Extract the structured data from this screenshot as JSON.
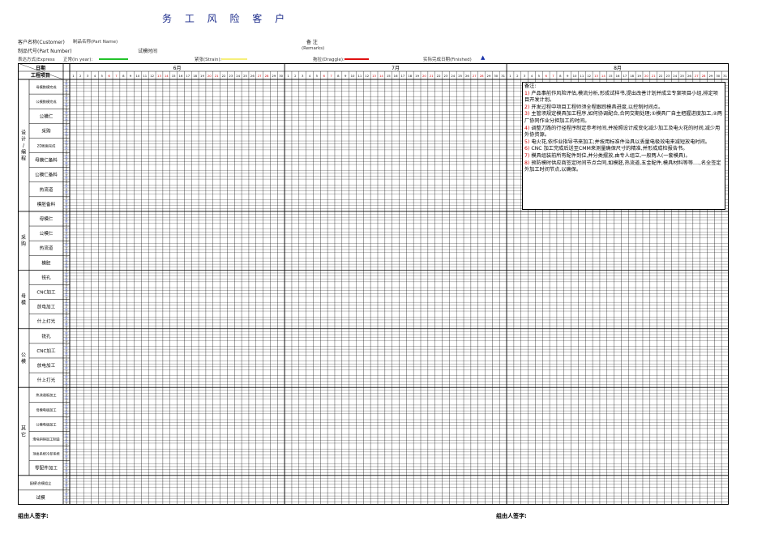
{
  "title": "<span class=\"t1\">务 工 风 险 客 户</span>",
  "header": {
    "customer_label": "客户名称(Customer)",
    "part_name_label": "制品名称(Part Name)",
    "part_number_label": "制品代号(Part Number)",
    "trial_time_label": "试模时间",
    "remarks_label": "备 注",
    "remarks_en": "(Remarks)",
    "express_label": "表达方式(Express",
    "normal_label": "正常(In year):",
    "tension_label": "紧张(Strain):",
    "struggle_label": "拖拉(Draggle):",
    "finished_label": "实际完成日期(Finished)",
    "colors": {
      "normal": "#22c32a",
      "tension": "#f6ef7a",
      "struggle": "#e01010",
      "finished": "#1a33aa"
    }
  },
  "months": [
    {
      "label": "6月",
      "days": 30
    },
    {
      "label": "7月",
      "days": 31
    },
    {
      "label": "8月",
      "days": 31
    }
  ],
  "left_header": {
    "date": "日期",
    "process": "工程项目"
  },
  "plan_labels": {
    "plan": "计",
    "actual": "实"
  },
  "groups": [
    {
      "label": "设计/编程",
      "items": [
        "母模数模完成",
        "公模数模完成",
        "公模仁",
        "采购",
        "2D图面完成",
        "母模仁备料",
        "公模仁备料",
        "热流道",
        "模胚备料"
      ]
    },
    {
      "label": "采购",
      "items": [
        "母模仁",
        "公模仁",
        "热流道",
        "模胚"
      ]
    },
    {
      "label": "母模",
      "items": [
        "铣孔",
        "CNC加工",
        "放电加工",
        "什上打光"
      ]
    },
    {
      "label": "公模",
      "items": [
        "铣孔",
        "CNC加工",
        "放电加工",
        "什上打光"
      ]
    },
    {
      "label": "其它",
      "items": [
        "热流道板加工",
        "母模电极加工",
        "公模电极加工",
        "滑块斜销加工制造",
        "顶出系统冷却系统",
        "零配件加工"
      ]
    },
    {
      "label": "",
      "items": [
        "配模\\合模组立",
        "试模"
      ]
    }
  ],
  "notes": {
    "title": "备注:",
    "items": [
      {
        "num": "1)",
        "text": "产品事前作风险评估,模流分析,形成试样书,提出改善计划并成立专案项目小组,排定项目开发计划。"
      },
      {
        "num": "2)",
        "text": "开发过程中项目工程师须全程跟踪模具进度,以控制时间点。"
      },
      {
        "num": "3)",
        "text": "主管须规定模具加工程序,如何协调配合,合同交期处理;①模具厂自主把握进度加工,②两厂协同作业分担加工的时间。"
      },
      {
        "num": "4)",
        "text": "调整刀路的行径程序制定参考时间,并按照设计成变化减少加工及电火花的时间,减少用外协资源。"
      },
      {
        "num": "5)",
        "text": "电火花,依作业指导书来加工;并按用标准件治具以丢量电极效电来减短放电时间。"
      },
      {
        "num": "6)",
        "text": "CNC 加工完成后送至CMM来测量确保尺寸的精准,并形成成检报告书。"
      },
      {
        "num": "7)",
        "text": "模具组装前所有配件到位,并分类摆放,由专人组立,一般两人(一套模具)。"
      },
      {
        "num": "8)",
        "text": "预防模时供应商签定时间节点合同,如模胚,热流道,五金配件,模具材料等等....,名全签定外加工时间节点,以确保。"
      }
    ]
  },
  "footer": {
    "left_sign": "组由人签字:",
    "right_sign": "组由人签字:"
  }
}
